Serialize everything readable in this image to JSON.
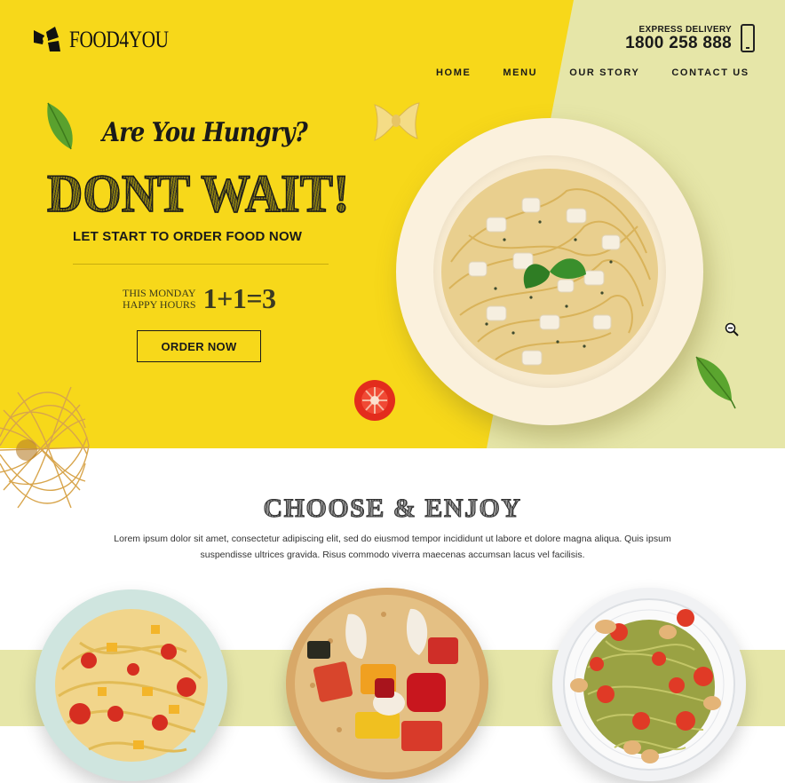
{
  "brand": {
    "name": "FOOD4YOU"
  },
  "contact": {
    "label": "EXPRESS DELIVERY",
    "phone": "1800 258 888"
  },
  "nav": {
    "items": [
      "HOME",
      "MENU",
      "OUR STORY",
      "CONTACT US"
    ]
  },
  "hero": {
    "tagline": "Are You Hungry?",
    "headline": "DONT WAIT!",
    "subheadline": "LET START TO ORDER FOOD NOW",
    "promo_line1": "THIS MONDAY",
    "promo_line2": "HAPPY HOURS",
    "promo_offer": "1+1=3",
    "cta_label": "ORDER NOW"
  },
  "section": {
    "title": "CHOOSE & ENJOY",
    "description": "Lorem ipsum dolor sit amet, consectetur adipiscing elit, sed do eiusmod tempor incididunt ut labore et dolore magna aliqua. Quis ipsum suspendisse ultrices gravida. Risus commodo viverra maecenas accumsan lacus vel facilisis."
  },
  "icons": [
    "bowtie-pasta-logo-icon",
    "mobile-phone-icon",
    "zoom-out-icon"
  ],
  "colors": {
    "hero_yellow": "#f7d81a",
    "hero_sage": "#e6e6a8",
    "text": "#1a1a1a"
  }
}
